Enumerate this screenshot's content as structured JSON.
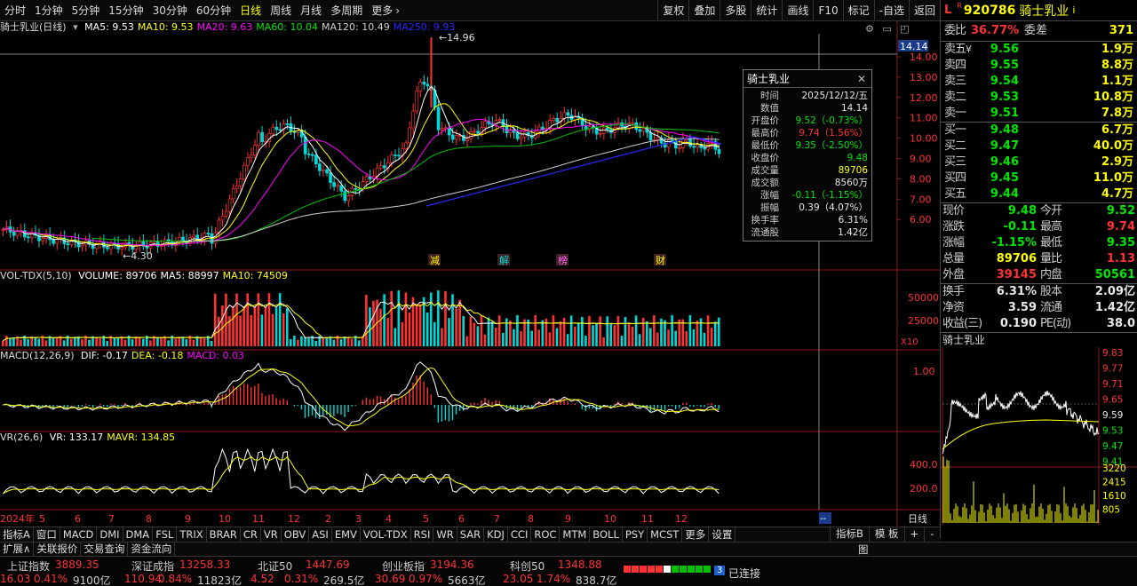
{
  "toolbar": {
    "periods": [
      "分时",
      "1分钟",
      "5分钟",
      "15分钟",
      "30分钟",
      "60分钟",
      "日线",
      "周线",
      "月线",
      "多周期",
      "更多"
    ],
    "active_period": "日线",
    "right_buttons": [
      "复权",
      "叠加",
      "多股",
      "统计",
      "画线",
      "F10",
      "标记",
      "-自选",
      "返回"
    ]
  },
  "main_panel": {
    "title": "骑士乳业(日线)",
    "ma": [
      {
        "label": "MA5: 9.53",
        "color": "#ffffff"
      },
      {
        "label": "MA10: 9.53",
        "color": "#ffff00"
      },
      {
        "label": "MA20: 9.63",
        "color": "#ff00ff"
      },
      {
        "label": "MA60: 10.04",
        "color": "#00e600"
      },
      {
        "label": "MA120: 10.49",
        "color": "#d0d0d0"
      },
      {
        "label": "MA250: 9.93",
        "color": "#2828ff"
      }
    ],
    "price_axis": [
      "14.00",
      "13.00",
      "12.00",
      "11.00",
      "10.00",
      "9.00",
      "8.00",
      "7.00",
      "6.00"
    ],
    "current_price_tag": "14.14",
    "high_label": "14.96",
    "low_label": "4.30",
    "events": [
      "减",
      "解",
      "榜",
      "财"
    ]
  },
  "tooltip": {
    "name": "骑士乳业",
    "close": "✕",
    "rows": [
      {
        "k": "时间",
        "v": "2025/12/12/五",
        "c": "#e8e8e8"
      },
      {
        "k": "数值",
        "v": "14.14",
        "c": "#e8e8e8"
      },
      {
        "k": "开盘价",
        "v": "9.52（-0.73%）",
        "c": "#00e600"
      },
      {
        "k": "最高价",
        "v": "9.74（1.56%）",
        "c": "#ff3232"
      },
      {
        "k": "最低价",
        "v": "9.35（-2.50%）",
        "c": "#00e600"
      },
      {
        "k": "收盘价",
        "v": "9.48",
        "c": "#00e600"
      },
      {
        "k": "成交量",
        "v": "89706",
        "c": "#ffff00"
      },
      {
        "k": "成交额",
        "v": "8560万",
        "c": "#e8e8e8"
      },
      {
        "k": "涨幅",
        "v": "-0.11（-1.15%）",
        "c": "#00e600"
      },
      {
        "k": "振幅",
        "v": "0.39（4.07%）",
        "c": "#e8e8e8"
      },
      {
        "k": "换手率",
        "v": "6.31%",
        "c": "#e8e8e8"
      },
      {
        "k": "流通股",
        "v": "1.42亿",
        "c": "#e8e8e8"
      }
    ]
  },
  "volume_panel": {
    "title": "VOL-TDX(5,10)",
    "items": [
      {
        "label": "VOLUME: 89706",
        "color": "#ffffff"
      },
      {
        "label": "MA5: 88997",
        "color": "#ffffff"
      },
      {
        "label": "MA10: 74509",
        "color": "#ffff00"
      }
    ],
    "axis": [
      "50000",
      "25000"
    ],
    "unit": "X10"
  },
  "macd_panel": {
    "title": "MACD(12,26,9)",
    "items": [
      {
        "label": "DIF: -0.17",
        "color": "#ffffff"
      },
      {
        "label": "DEA: -0.18",
        "color": "#ffff00"
      },
      {
        "label": "MACD: 0.03",
        "color": "#ff00ff"
      }
    ],
    "axis": [
      "1.00"
    ]
  },
  "vr_panel": {
    "title": "VR(26,6)",
    "items": [
      {
        "label": "VR: 133.17",
        "color": "#ffffff"
      },
      {
        "label": "MAVR: 134.85",
        "color": "#ffff00"
      }
    ],
    "axis": [
      "400.0",
      "200.0"
    ]
  },
  "date_axis": [
    "2024年",
    "5",
    "6",
    "7",
    "8",
    "9",
    "10",
    "11",
    "12",
    "2",
    "3",
    "4",
    "5",
    "6",
    "7",
    "8",
    "9",
    "10",
    "11",
    "12"
  ],
  "date_tag": "--",
  "quote": {
    "code": "920786",
    "name": "骑士乳业",
    "flag_l": "L",
    "flag_r": "R",
    "info_icon": "i",
    "weibi_label": "委比",
    "weibi": "36.77%",
    "weicha_label": "委差",
    "weicha": "371",
    "sell": [
      {
        "l": "卖五",
        "p": "9.56",
        "v": "1.9万",
        "yen": "¥"
      },
      {
        "l": "卖四",
        "p": "9.55",
        "v": "8.8万"
      },
      {
        "l": "卖三",
        "p": "9.54",
        "v": "1.1万"
      },
      {
        "l": "卖二",
        "p": "9.53",
        "v": "10.8万"
      },
      {
        "l": "卖一",
        "p": "9.51",
        "v": "7.8万"
      }
    ],
    "buy": [
      {
        "l": "买一",
        "p": "9.48",
        "v": "6.7万"
      },
      {
        "l": "买二",
        "p": "9.47",
        "v": "40.0万"
      },
      {
        "l": "买三",
        "p": "9.46",
        "v": "2.9万"
      },
      {
        "l": "买四",
        "p": "9.45",
        "v": "11.0万"
      },
      {
        "l": "买五",
        "p": "9.44",
        "v": "4.7万"
      }
    ],
    "stats": [
      {
        "l": "现价",
        "v": "9.48",
        "vc": "#00e600",
        "l2": "今开",
        "v2": "9.52",
        "v2c": "#00e600"
      },
      {
        "l": "涨跌",
        "v": "-0.11",
        "vc": "#00e600",
        "l2": "最高",
        "v2": "9.74",
        "v2c": "#ff3232"
      },
      {
        "l": "涨幅",
        "v": "-1.15%",
        "vc": "#00e600",
        "l2": "最低",
        "v2": "9.35",
        "v2c": "#00e600"
      },
      {
        "l": "总量",
        "v": "89706",
        "vc": "#ffff00",
        "l2": "量比",
        "v2": "1.13",
        "v2c": "#ff3232"
      },
      {
        "l": "外盘",
        "v": "39145",
        "vc": "#ff3232",
        "l2": "内盘",
        "v2": "50561",
        "v2c": "#00e600"
      }
    ],
    "stats2": [
      {
        "l": "换手",
        "v": "6.31%",
        "l2": "股本",
        "v2": "2.09亿"
      },
      {
        "l": "净资",
        "v": "3.59",
        "l2": "流通",
        "v2": "1.42亿"
      },
      {
        "l": "收益(三)",
        "v": "0.190",
        "l2": "PE(动)",
        "v2": "38.0"
      }
    ],
    "mini_title": "骑士乳业",
    "mini_axis": [
      "9.83",
      "9.77",
      "9.71",
      "9.65",
      "9.59",
      "9.53",
      "9.47",
      "9.41",
      "3220",
      "2415",
      "1610",
      "805"
    ]
  },
  "indicator_tabs": [
    "指标A",
    "窗口",
    "MACD",
    "DMI",
    "DMA",
    "FSL",
    "TRIX",
    "BRAR",
    "CR",
    "VR",
    "OBV",
    "ASI",
    "EMV",
    "VOL-TDX",
    "RSI",
    "WR",
    "SAR",
    "KDJ",
    "CCI",
    "ROC",
    "MTM",
    "BOLL",
    "PSY",
    "MCST",
    "更多",
    "设置"
  ],
  "indicator_right": [
    "指标B",
    "模 板",
    "+",
    "-"
  ],
  "bottom_tabs": [
    "扩展∧",
    "关联报价",
    "交易查询",
    "资金流向"
  ],
  "bottom_right": "图",
  "indices": [
    {
      "name": "上证指数",
      "val": "3889.35",
      "chg": "16.03",
      "pct": "0.41%",
      "amt": "9100亿"
    },
    {
      "name": "深证成指",
      "val": "13258.33",
      "chg": "110.94",
      "pct": "0.84%",
      "amt": "11823亿"
    },
    {
      "name": "北证50",
      "val": "1447.69",
      "chg": "4.52",
      "pct": "0.31%",
      "amt": "269.5亿"
    },
    {
      "name": "创业板指",
      "val": "3194.36",
      "chg": "30.69",
      "pct": "0.97%",
      "amt": "5663亿"
    },
    {
      "name": "科创50",
      "val": "1348.88",
      "chg": "23.05",
      "pct": "1.74%",
      "amt": "838.7亿"
    }
  ],
  "connection": {
    "badge": "3",
    "text": "已连接"
  },
  "colors": {
    "up": "#ff3232",
    "down": "#00e600",
    "accent": "#ffff00"
  }
}
